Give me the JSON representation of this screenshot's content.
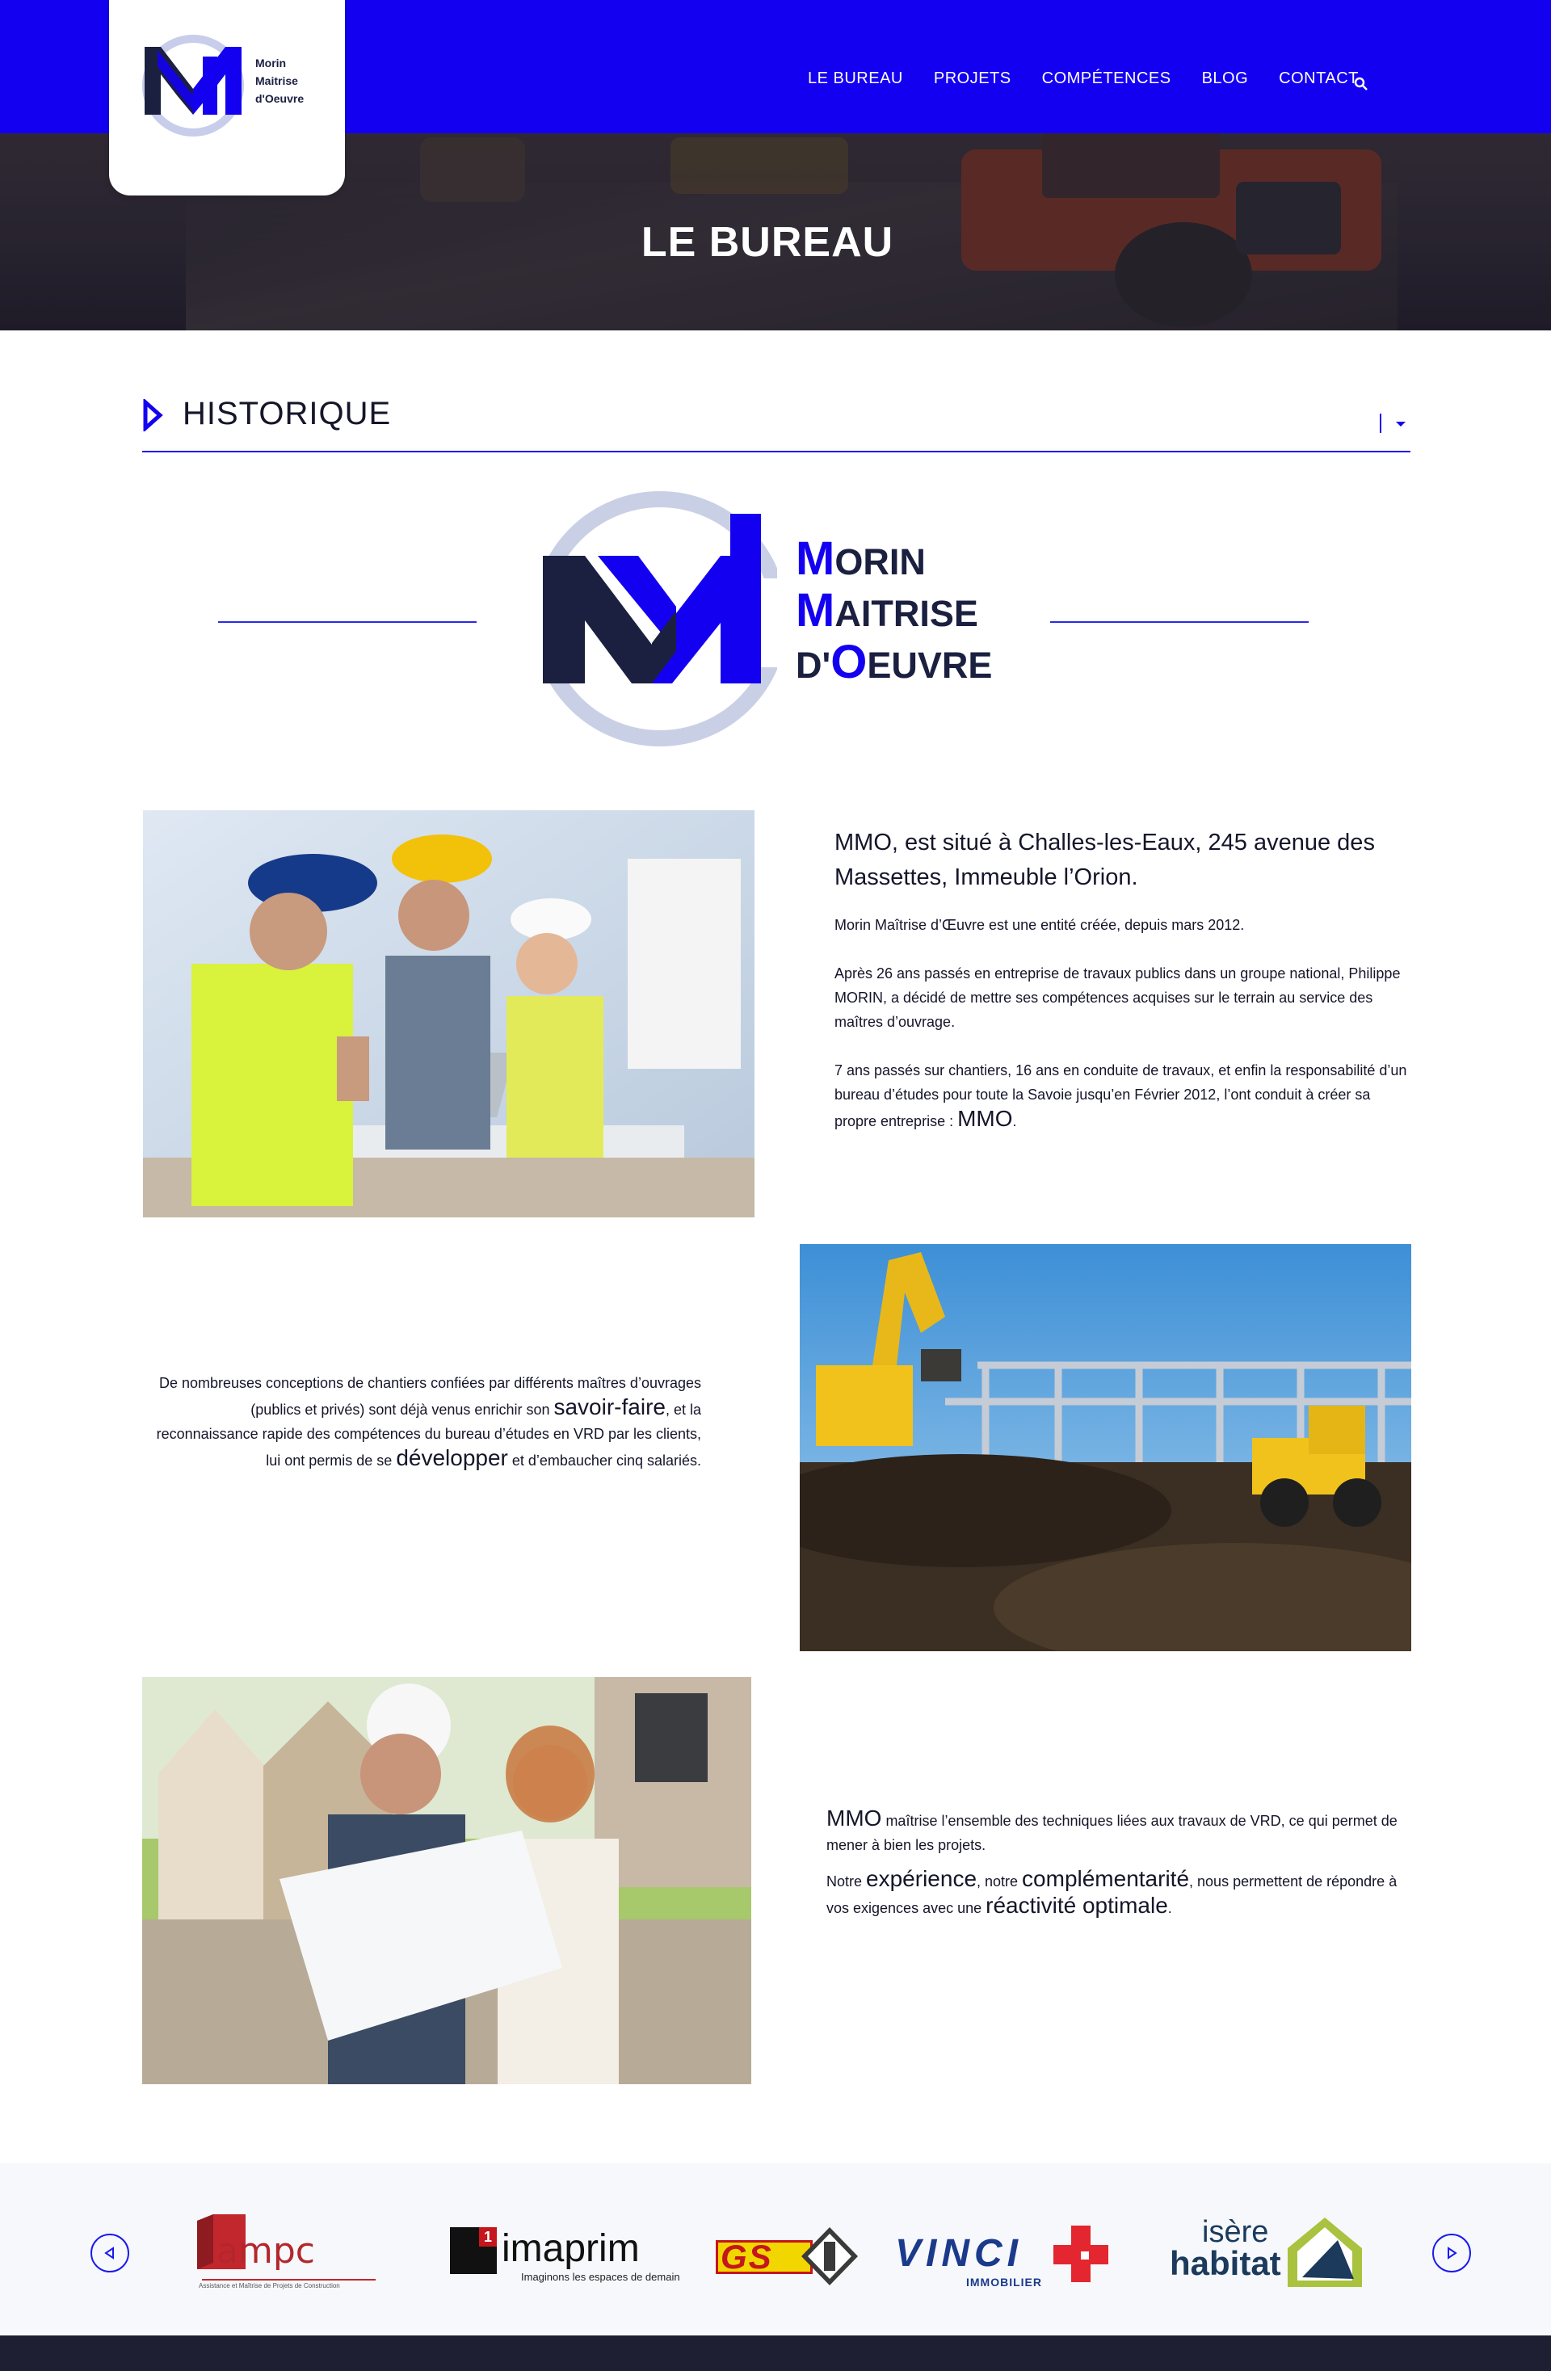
{
  "nav": {
    "items": [
      "LE BUREAU",
      "PROJETS",
      "COMPÉTENCES",
      "BLOG",
      "CONTACT"
    ],
    "search_icon": "search-icon"
  },
  "logo": {
    "line1": "Morin",
    "line2": "Maitrise",
    "line3": "d'Oeuvre"
  },
  "hero": {
    "title": "LE BUREAU"
  },
  "section": {
    "title": "HISTORIQUE",
    "toggle_icon": "caret-down-icon"
  },
  "big_logo": {
    "l1_cap": "M",
    "l1_rest": "ORIN",
    "l2_cap": "M",
    "l2_rest": "AITRISE",
    "l3_pre": "D'",
    "l3_cap": "O",
    "l3_rest": "EUVRE"
  },
  "block1": {
    "lead": "MMO, est situé à Challes-les-Eaux, 245 avenue des Massettes, Immeuble l’Orion.",
    "p1": "Morin Maîtrise d’Œuvre est une entité créée, depuis mars 2012.",
    "p2": "Après 26 ans passés en entreprise de travaux publics dans un groupe national, Philippe MORIN, a décidé de mettre ses compétences acquises sur le terrain au service des maîtres d’ouvrage.",
    "p3_a": "7 ans passés sur chantiers, 16 ans en conduite de travaux, et enfin la responsabilité d’un bureau d’études pour toute la Savoie jusqu’en Février 2012, l’ont conduit à créer sa propre entreprise : ",
    "p3_big": "MMO",
    "p3_end": "."
  },
  "block2": {
    "a": "De nombreuses conceptions de chantiers confiées par différents maîtres d’ouvrages (publics et privés) sont déjà venus enrichir son ",
    "big1": "savoir-faire",
    "b": ", et la reconnaissance rapide des compétences du bureau d’études en VRD par les clients, lui ont permis de se ",
    "big2": "développer",
    "c": " et d’embaucher cinq salariés."
  },
  "block3": {
    "big1": "MMO",
    "a": " maîtrise l’ensemble des techniques liées aux travaux de VRD, ce qui permet de mener à bien les projets.",
    "b": "Notre ",
    "big2": "expérience",
    "c": ", notre ",
    "big3": "complémentarité",
    "d": ", nous permettent de répondre à vos exigences avec une ",
    "big4": "réactivité optimale",
    "e": "."
  },
  "partners": {
    "ampc": {
      "name": "ampc",
      "tagline": "Assistance et Maîtrise de Projets de Construction"
    },
    "imaprim": {
      "num": "1",
      "name": "imaprim",
      "tagline": "Imaginons les espaces de demain"
    },
    "gsi": {
      "name": "GS"
    },
    "vinci": {
      "name": "VINCI",
      "sub": "IMMOBILIER"
    },
    "isere": {
      "line1": "isère",
      "line2": "habitat"
    }
  },
  "colors": {
    "brand_blue": "#1400f0",
    "navy": "#1b2040",
    "footer": "#1e1f33"
  }
}
